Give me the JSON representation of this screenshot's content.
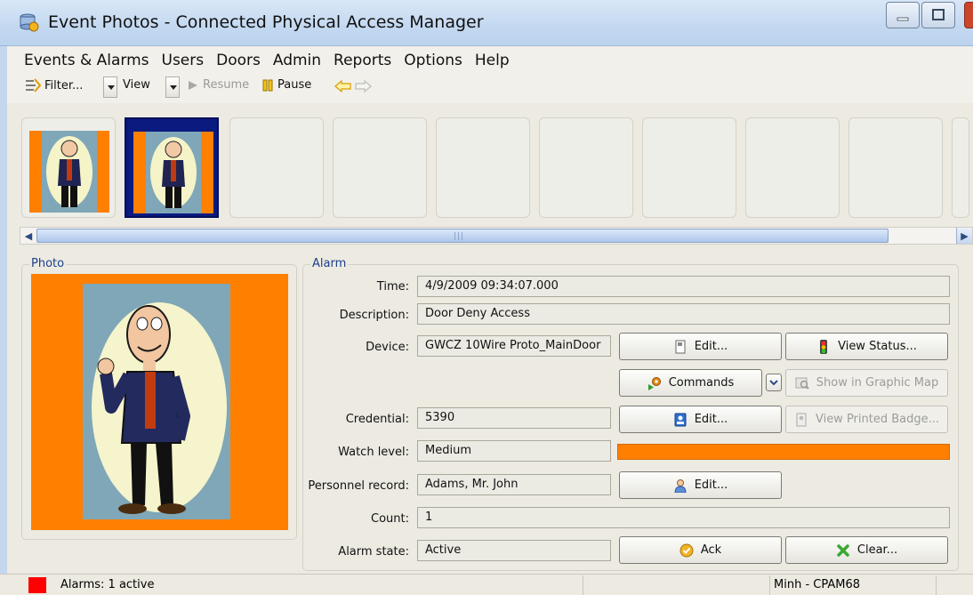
{
  "window": {
    "title": "Event Photos - Connected Physical Access Manager"
  },
  "menu": [
    "Events & Alarms",
    "Users",
    "Doors",
    "Admin",
    "Reports",
    "Options",
    "Help"
  ],
  "toolbar": {
    "filter_label": "Filter...",
    "view_label": "View",
    "resume_label": "Resume",
    "pause_label": "Pause"
  },
  "photo": {
    "group_label": "Photo"
  },
  "alarm": {
    "group_label": "Alarm",
    "time_label": "Time:",
    "time_value": "4/9/2009 09:34:07.000",
    "description_label": "Description:",
    "description_value": "Door Deny Access",
    "device_label": "Device:",
    "device_value": "GWCZ 10Wire Proto_MainDoor",
    "device_edit_label": "Edit...",
    "view_status_label": "View Status...",
    "commands_label": "Commands",
    "graphic_map_label": "Show in Graphic Map",
    "credential_label": "Credential:",
    "credential_value": "5390",
    "credential_edit_label": "Edit...",
    "view_badge_label": "View Printed Badge...",
    "watch_level_label": "Watch level:",
    "watch_level_value": "Medium",
    "watch_level_color": "#ff7f00",
    "personnel_label": "Personnel record:",
    "personnel_value": "Adams, Mr. John",
    "personnel_edit_label": "Edit...",
    "count_label": "Count:",
    "count_value": "1",
    "state_label": "Alarm state:",
    "state_value": "Active",
    "ack_label": "Ack",
    "clear_label": "Clear..."
  },
  "status": {
    "alarms_text": "Alarms: 1 active",
    "alarm_color": "#ff0000",
    "user_text": "Minh - CPAM68"
  }
}
